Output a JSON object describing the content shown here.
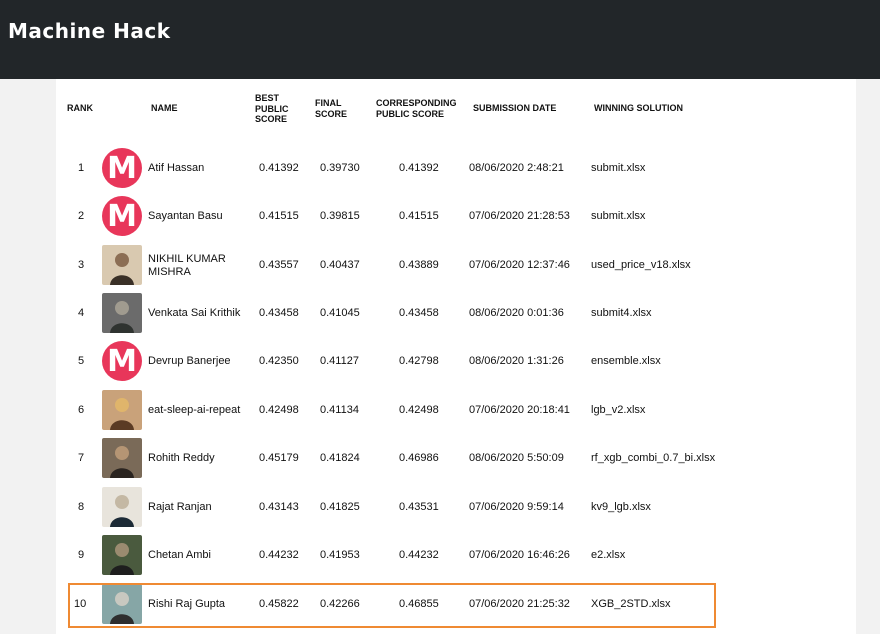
{
  "app": {
    "logo_text": "Machine Hack"
  },
  "headers": {
    "rank": "RANK",
    "name": "NAME",
    "best": "BEST\nPUBLIC\nSCORE",
    "final": "FINAL\nSCORE",
    "corr": "CORRESPONDING\nPUBLIC SCORE",
    "date": "SUBMISSION DATE",
    "solution": "WINNING SOLUTION"
  },
  "rows": [
    {
      "rank": "1",
      "name": "Atif Hassan",
      "best": "0.41392",
      "final": "0.39730",
      "corr": "0.41392",
      "date": "08/06/2020 2:48:21",
      "solution": "submit.xlsx",
      "avatar": "M"
    },
    {
      "rank": "2",
      "name": "Sayantan Basu",
      "best": "0.41515",
      "final": "0.39815",
      "corr": "0.41515",
      "date": "07/06/2020 21:28:53",
      "solution": "submit.xlsx",
      "avatar": "M"
    },
    {
      "rank": "3",
      "name": "NIKHIL KUMAR\nMISHRA",
      "best": "0.43557",
      "final": "0.40437",
      "corr": "0.43889",
      "date": "07/06/2020 12:37:46",
      "solution": "used_price_v18.xlsx",
      "avatar": "photo"
    },
    {
      "rank": "4",
      "name": "Venkata Sai Krithik",
      "best": "0.43458",
      "final": "0.41045",
      "corr": "0.43458",
      "date": "08/06/2020 0:01:36",
      "solution": "submit4.xlsx",
      "avatar": "photo"
    },
    {
      "rank": "5",
      "name": "Devrup Banerjee",
      "best": "0.42350",
      "final": "0.41127",
      "corr": "0.42798",
      "date": "08/06/2020 1:31:26",
      "solution": "ensemble.xlsx",
      "avatar": "M"
    },
    {
      "rank": "6",
      "name": "eat-sleep-ai-repeat",
      "best": "0.42498",
      "final": "0.41134",
      "corr": "0.42498",
      "date": "07/06/2020 20:18:41",
      "solution": "lgb_v2.xlsx",
      "avatar": "photo"
    },
    {
      "rank": "7",
      "name": "Rohith Reddy",
      "best": "0.45179",
      "final": "0.41824",
      "corr": "0.46986",
      "date": "08/06/2020 5:50:09",
      "solution": "rf_xgb_combi_0.7_bi.xlsx",
      "avatar": "photo"
    },
    {
      "rank": "8",
      "name": "Rajat Ranjan",
      "best": "0.43143",
      "final": "0.41825",
      "corr": "0.43531",
      "date": "07/06/2020 9:59:14",
      "solution": "kv9_lgb.xlsx",
      "avatar": "photo"
    },
    {
      "rank": "9",
      "name": "Chetan Ambi",
      "best": "0.44232",
      "final": "0.41953",
      "corr": "0.44232",
      "date": "07/06/2020 16:46:26",
      "solution": "e2.xlsx",
      "avatar": "photo"
    },
    {
      "rank": "10",
      "name": "Rishi Raj Gupta",
      "best": "0.45822",
      "final": "0.42266",
      "corr": "0.46855",
      "date": "07/06/2020 21:25:32",
      "solution": "XGB_2STD.xlsx",
      "avatar": "photo"
    }
  ],
  "colors": {
    "header_bg": "#222629",
    "avatar_m": "#e8365a",
    "highlight": "#ef8a33"
  }
}
